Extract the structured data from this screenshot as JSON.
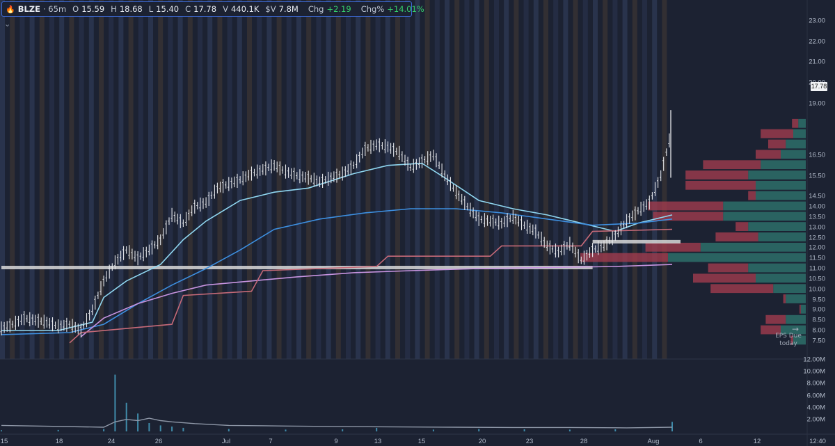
{
  "info_bar": {
    "symbol": "BLZE",
    "interval": "· 65m",
    "open_label": "O",
    "open": "15.59",
    "high_label": "H",
    "high": "18.68",
    "low_label": "L",
    "low": "15.40",
    "close_label": "C",
    "close": "17.78",
    "volume_label": "V",
    "volume": "440.1K",
    "dollar_vol_label": "$V",
    "dollar_vol": "7.8M",
    "chg_label": "Chg",
    "chg": "+2.19",
    "chgpct_label": "Chg%",
    "chgpct": "+14.01%"
  },
  "last_price_tag": "17.78",
  "event_marker": {
    "line1": "EPS Due",
    "line2": "today"
  },
  "chart_data": {
    "type": "candlestick",
    "symbol": "BLZE",
    "interval": "65m",
    "price_axis": {
      "ticks": [
        "23.00",
        "22.00",
        "21.00",
        "20.00",
        "19.00",
        "17.78",
        "16.50",
        "15.50",
        "14.50",
        "14.00",
        "13.50",
        "13.00",
        "12.50",
        "12.00",
        "11.50",
        "11.00",
        "10.50",
        "10.00",
        "9.50",
        "9.00",
        "8.50",
        "8.00",
        "7.50"
      ],
      "ylim": [
        7.3,
        23.5
      ]
    },
    "volume_axis": {
      "ticks": [
        "12.00M",
        "10.00M",
        "8.00M",
        "6.00M",
        "4.00M",
        "2.00M"
      ],
      "ylim": [
        0,
        12000000
      ]
    },
    "time_axis": {
      "labels": [
        "15",
        "18",
        "24",
        "26",
        "Jul",
        "7",
        "9",
        "13",
        "15",
        "20",
        "23",
        "28",
        "Aug",
        "6",
        "12",
        "12:40"
      ]
    },
    "price_path": [
      [
        0,
        8.1
      ],
      [
        1,
        8.3
      ],
      [
        2,
        8.6
      ],
      [
        3,
        8.5
      ],
      [
        4,
        8.4
      ],
      [
        5,
        8.2
      ],
      [
        6,
        8.3
      ],
      [
        7,
        8.0
      ],
      [
        8,
        9.0
      ],
      [
        9,
        10.4
      ],
      [
        10,
        11.3
      ],
      [
        11,
        11.9
      ],
      [
        12,
        11.5
      ],
      [
        13,
        11.9
      ],
      [
        14,
        12.4
      ],
      [
        15,
        13.6
      ],
      [
        16,
        13.2
      ],
      [
        17,
        14.0
      ],
      [
        18,
        14.2
      ],
      [
        19,
        14.9
      ],
      [
        20,
        15.1
      ],
      [
        21,
        15.3
      ],
      [
        22,
        15.6
      ],
      [
        23,
        15.8
      ],
      [
        24,
        16.0
      ],
      [
        25,
        15.7
      ],
      [
        26,
        15.5
      ],
      [
        27,
        15.4
      ],
      [
        28,
        15.2
      ],
      [
        29,
        15.4
      ],
      [
        30,
        15.6
      ],
      [
        31,
        16.0
      ],
      [
        32,
        16.8
      ],
      [
        33,
        17.0
      ],
      [
        34,
        16.9
      ],
      [
        35,
        16.6
      ],
      [
        36,
        15.9
      ],
      [
        37,
        16.2
      ],
      [
        38,
        16.5
      ],
      [
        39,
        15.5
      ],
      [
        40,
        14.7
      ],
      [
        41,
        14.0
      ],
      [
        42,
        13.4
      ],
      [
        43,
        13.3
      ],
      [
        44,
        13.2
      ],
      [
        45,
        13.5
      ],
      [
        46,
        13.1
      ],
      [
        47,
        12.8
      ],
      [
        48,
        12.1
      ],
      [
        49,
        11.8
      ],
      [
        50,
        12.2
      ],
      [
        51,
        11.4
      ],
      [
        52,
        11.9
      ],
      [
        53,
        12.1
      ],
      [
        54,
        12.6
      ],
      [
        55,
        13.3
      ],
      [
        56,
        13.8
      ],
      [
        57,
        14.2
      ],
      [
        58,
        15.5
      ],
      [
        59,
        17.78
      ]
    ],
    "overlays": [
      {
        "name": "",
        "color": "#8fd6f0",
        "points": [
          [
            0,
            8.0
          ],
          [
            5,
            8.0
          ],
          [
            8,
            8.4
          ],
          [
            9,
            9.6
          ],
          [
            11,
            10.4
          ],
          [
            14,
            11.2
          ],
          [
            16,
            12.4
          ],
          [
            18,
            13.3
          ],
          [
            21,
            14.3
          ],
          [
            24,
            14.7
          ],
          [
            27,
            14.9
          ],
          [
            31,
            15.6
          ],
          [
            34,
            16.0
          ],
          [
            37,
            16.1
          ],
          [
            39,
            15.4
          ],
          [
            42,
            14.3
          ],
          [
            45,
            13.9
          ],
          [
            48,
            13.6
          ],
          [
            51,
            13.2
          ],
          [
            54,
            12.8
          ],
          [
            56,
            13.2
          ],
          [
            59,
            13.6
          ]
        ]
      },
      {
        "name": "",
        "color": "#3d8fe0",
        "points": [
          [
            0,
            7.8
          ],
          [
            6,
            7.9
          ],
          [
            9,
            8.3
          ],
          [
            12,
            9.3
          ],
          [
            15,
            10.2
          ],
          [
            18,
            11.0
          ],
          [
            21,
            11.9
          ],
          [
            24,
            12.9
          ],
          [
            28,
            13.4
          ],
          [
            32,
            13.7
          ],
          [
            36,
            13.9
          ],
          [
            40,
            13.9
          ],
          [
            44,
            13.7
          ],
          [
            48,
            13.4
          ],
          [
            52,
            13.1
          ],
          [
            56,
            13.2
          ],
          [
            59,
            13.4
          ]
        ]
      },
      {
        "name": "",
        "color": "#c894e0",
        "points": [
          [
            7,
            7.7
          ],
          [
            9,
            8.6
          ],
          [
            12,
            9.3
          ],
          [
            15,
            9.8
          ],
          [
            18,
            10.2
          ],
          [
            22,
            10.4
          ],
          [
            26,
            10.6
          ],
          [
            31,
            10.8
          ],
          [
            36,
            10.9
          ],
          [
            42,
            11.0
          ],
          [
            48,
            11.05
          ],
          [
            54,
            11.1
          ],
          [
            59,
            11.2
          ]
        ]
      },
      {
        "name": "",
        "color": "#c66a78",
        "points": [
          [
            6,
            7.4
          ],
          [
            7,
            7.9
          ],
          [
            15,
            8.3
          ],
          [
            16,
            9.7
          ],
          [
            22,
            9.9
          ],
          [
            23,
            10.9
          ],
          [
            33,
            11.1
          ],
          [
            34,
            11.6
          ],
          [
            43,
            11.6
          ],
          [
            44,
            12.1
          ],
          [
            51,
            12.1
          ],
          [
            52,
            12.8
          ],
          [
            59,
            12.9
          ]
        ]
      }
    ],
    "levels": [
      {
        "price": 11.05,
        "from": 0,
        "to": 52,
        "color": "#d9d9d9"
      },
      {
        "price": 12.3,
        "from": 52,
        "to": 61,
        "color": "#d9d9d9"
      }
    ],
    "volume_profile": [
      {
        "price": 7.5,
        "up": 1.0,
        "down": 0.2
      },
      {
        "price": 8.0,
        "up": 2.0,
        "down": 1.6
      },
      {
        "price": 8.5,
        "up": 1.6,
        "down": 1.6
      },
      {
        "price": 9.0,
        "up": 0.4,
        "down": 0.1
      },
      {
        "price": 9.5,
        "up": 1.6,
        "down": 0.2
      },
      {
        "price": 10.0,
        "up": 2.6,
        "down": 5.0
      },
      {
        "price": 10.5,
        "up": 4.0,
        "down": 5.0
      },
      {
        "price": 11.0,
        "up": 4.6,
        "down": 3.2
      },
      {
        "price": 11.5,
        "up": 11.0,
        "down": 7.0
      },
      {
        "price": 12.0,
        "up": 8.4,
        "down": 4.4
      },
      {
        "price": 12.5,
        "up": 3.8,
        "down": 3.4
      },
      {
        "price": 13.0,
        "up": 4.6,
        "down": 1.0
      },
      {
        "price": 13.5,
        "up": 6.6,
        "down": 5.6
      },
      {
        "price": 14.0,
        "up": 6.6,
        "down": 6.0
      },
      {
        "price": 14.5,
        "up": 4.0,
        "down": 0.6
      },
      {
        "price": 15.0,
        "up": 4.0,
        "down": 5.6
      },
      {
        "price": 15.5,
        "up": 4.6,
        "down": 5.0
      },
      {
        "price": 16.0,
        "up": 3.6,
        "down": 4.6
      },
      {
        "price": 16.5,
        "up": 2.0,
        "down": 2.0
      },
      {
        "price": 17.0,
        "up": 1.6,
        "down": 1.4
      },
      {
        "price": 17.5,
        "up": 1.0,
        "down": 2.6
      },
      {
        "price": 18.0,
        "up": 0.6,
        "down": 0.5
      }
    ],
    "volume_bars": [
      [
        0,
        0.2
      ],
      [
        5,
        0.25
      ],
      [
        9,
        0.4
      ],
      [
        10,
        9.5
      ],
      [
        11,
        4.8
      ],
      [
        12,
        3.0
      ],
      [
        13,
        1.4
      ],
      [
        14,
        1.0
      ],
      [
        15,
        0.8
      ],
      [
        16,
        0.6
      ],
      [
        20,
        0.4
      ],
      [
        25,
        0.3
      ],
      [
        30,
        0.35
      ],
      [
        33,
        0.6
      ],
      [
        38,
        0.3
      ],
      [
        42,
        0.4
      ],
      [
        46,
        0.35
      ],
      [
        50,
        0.3
      ],
      [
        54,
        0.35
      ],
      [
        59,
        1.6
      ]
    ],
    "volume_ma": [
      [
        0,
        1.0
      ],
      [
        9,
        0.7
      ],
      [
        10,
        1.6
      ],
      [
        11,
        2.0
      ],
      [
        12,
        1.8
      ],
      [
        13,
        2.2
      ],
      [
        14,
        1.8
      ],
      [
        15,
        1.6
      ],
      [
        17,
        1.3
      ],
      [
        20,
        1.0
      ],
      [
        25,
        0.9
      ],
      [
        30,
        0.8
      ],
      [
        35,
        0.75
      ],
      [
        40,
        0.7
      ],
      [
        45,
        0.65
      ],
      [
        50,
        0.65
      ],
      [
        55,
        0.6
      ],
      [
        59,
        0.7
      ]
    ]
  }
}
